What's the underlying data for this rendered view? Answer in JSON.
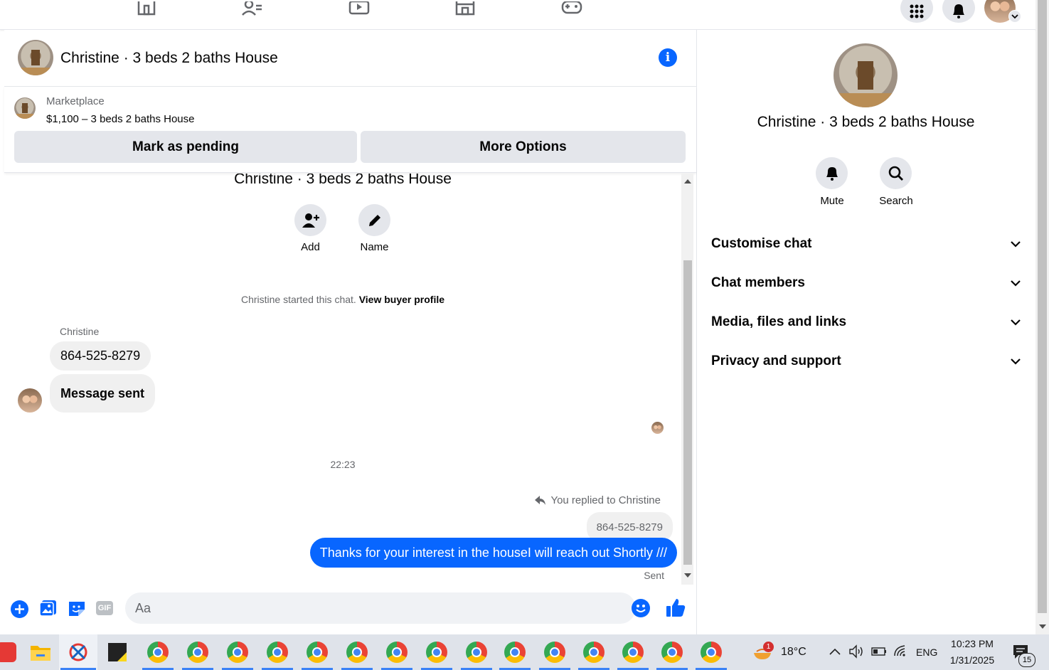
{
  "header": {
    "title": "Christine · 3 beds 2 baths House"
  },
  "marketplace": {
    "label": "Marketplace",
    "listing": "$1,100 – 3 beds 2 baths House",
    "mark_pending": "Mark as pending",
    "more_options": "More Options"
  },
  "thread": {
    "title": "Christine · 3 beds 2 baths House",
    "add_label": "Add",
    "name_label": "Name",
    "started_text": "Christine started this chat.",
    "view_profile": "View buyer profile",
    "sender_name": "Christine",
    "incoming_messages": [
      "864-525-8279",
      "Message sent"
    ],
    "time": "22:23",
    "replied_text": "You replied to Christine",
    "quoted": "864-525-8279",
    "outgoing": "Thanks for your interest in the houseI will reach out Shortly ///",
    "status": "Sent"
  },
  "composer": {
    "placeholder": "Aa"
  },
  "details": {
    "title": "Christine · 3 beds 2 baths House",
    "mute": "Mute",
    "search": "Search",
    "sections": [
      "Customise chat",
      "Chat members",
      "Media, files and links",
      "Privacy and support"
    ]
  },
  "taskbar": {
    "notif_count": "1",
    "weather": "18°C",
    "language": "ENG",
    "time": "10:23 PM",
    "date": "1/31/2025",
    "notifications": "15"
  },
  "colors": {
    "accent": "#0866ff",
    "bubble_in": "#f0f0f0",
    "button_gray": "#e4e6eb"
  }
}
